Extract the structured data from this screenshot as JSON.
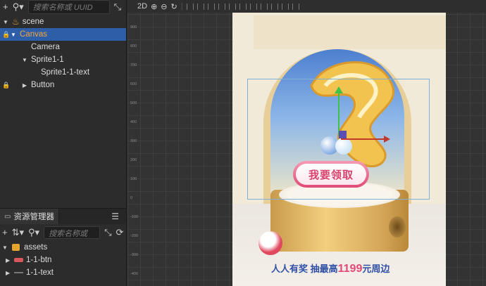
{
  "hierarchy": {
    "search_placeholder": "搜索名称或 UUID",
    "nodes": [
      {
        "label": "scene"
      },
      {
        "label": "Canvas"
      },
      {
        "label": "Camera"
      },
      {
        "label": "Sprite1-1"
      },
      {
        "label": "Sprite1-1-text"
      },
      {
        "label": "Button"
      }
    ]
  },
  "assets": {
    "tab_label": "资源管理器",
    "search_placeholder": "搜索名称或",
    "items": [
      {
        "label": "assets"
      },
      {
        "label": "1-1-btn"
      },
      {
        "label": "1-1-text"
      }
    ]
  },
  "scene_view": {
    "mode_label": "2D",
    "ruler_ticks": [
      "900",
      "800",
      "700",
      "600",
      "500",
      "400",
      "300",
      "200",
      "100",
      "0",
      "-100",
      "-200",
      "-300",
      "-400"
    ],
    "claim_button_text": "我要领取",
    "promo_prefix": "人人有奖 抽最高",
    "promo_amount": "1199",
    "promo_suffix": "元周边"
  },
  "colors": {
    "selection": "#2f5ea8",
    "selected_text": "#f0a640",
    "accent_pink": "#e04a77",
    "promo_blue": "#3050a8"
  }
}
